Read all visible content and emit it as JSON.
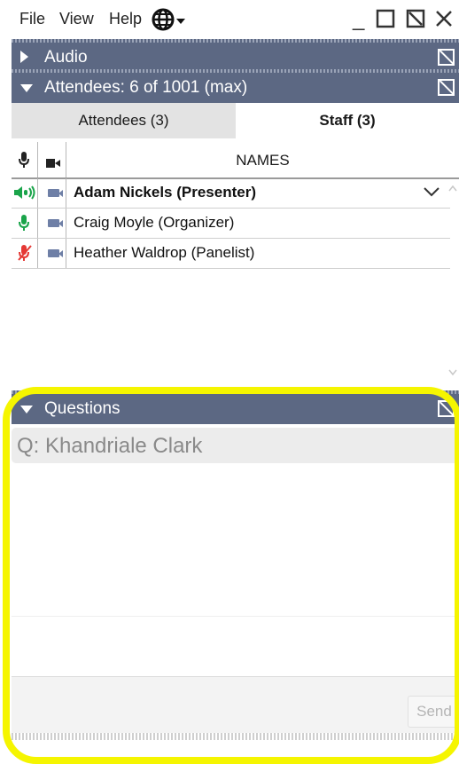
{
  "menu": {
    "file": "File",
    "view": "View",
    "help": "Help"
  },
  "window": {
    "minimize": "_",
    "maximize": "☐",
    "popout": "⧅",
    "close": "✕"
  },
  "panels": {
    "audio": {
      "label": "Audio"
    },
    "attendees": {
      "label": "Attendees:  6 of 1001 (max)"
    },
    "questions": {
      "label": "Questions"
    }
  },
  "tabs": {
    "attendees": "Attendees (3)",
    "staff": "Staff (3)",
    "active": "staff"
  },
  "table": {
    "names_header": "NAMES"
  },
  "staff": [
    {
      "name": "Adam Nickels (Presenter)",
      "mic": "speaking",
      "bold": true
    },
    {
      "name": "Craig Moyle (Organizer)",
      "mic": "on",
      "bold": false
    },
    {
      "name": "Heather Waldrop (Panelist)",
      "mic": "muted",
      "bold": false
    }
  ],
  "questions": {
    "question_from": "Q: Khandriale Clark",
    "send_label": "Send"
  },
  "colors": {
    "panel_header": "#5c6883",
    "mic_on": "#1aa44a",
    "mic_muted": "#e53935",
    "camera": "#6e7fa6",
    "highlight": "#f5f500"
  }
}
